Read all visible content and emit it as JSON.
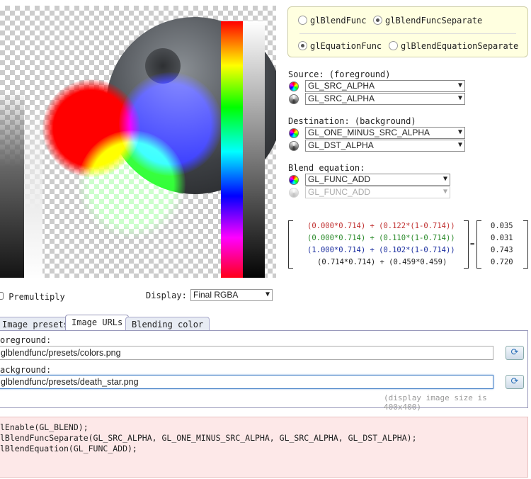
{
  "blend_function": {
    "options": [
      {
        "label": "glBlendFunc",
        "selected": false
      },
      {
        "label": "glBlendFuncSeparate",
        "selected": true
      }
    ]
  },
  "blend_equation_function": {
    "options": [
      {
        "label": "glEquationFunc",
        "selected": true
      },
      {
        "label": "glBlendEquationSeparate",
        "selected": false
      }
    ]
  },
  "source": {
    "label": "Source: (foreground)",
    "rgb": "GL_SRC_ALPHA",
    "alpha": "GL_SRC_ALPHA"
  },
  "destination": {
    "label": "Destination: (background)",
    "rgb": "GL_ONE_MINUS_SRC_ALPHA",
    "alpha": "GL_DST_ALPHA"
  },
  "equation": {
    "label": "Blend equation:",
    "rgb": "GL_FUNC_ADD",
    "alpha": "GL_FUNC_ADD"
  },
  "formula": {
    "rows": [
      {
        "expr": "(0.000*0.714) + (0.122*(1-0.714))",
        "result": "0.035",
        "color": "#c03030"
      },
      {
        "expr": "(0.000*0.714) + (0.110*(1-0.714))",
        "result": "0.031",
        "color": "#2a8a2a"
      },
      {
        "expr": "(1.000*0.714) + (0.102*(1-0.714))",
        "result": "0.743",
        "color": "#1c2fa0"
      },
      {
        "expr": "(0.714*0.714) + (0.459*0.459)",
        "result": "0.720",
        "color": "#222222"
      }
    ],
    "equals": "="
  },
  "premultiply_label": "Premultiply",
  "display": {
    "label": "Display:",
    "value": "Final RGBA"
  },
  "tabs": [
    {
      "label": "Image presets",
      "active": false
    },
    {
      "label": "Image URLs",
      "active": true
    },
    {
      "label": "Blending color",
      "active": false
    }
  ],
  "urls": {
    "foreground_label": "oreground:",
    "foreground_value": "glblendfunc/presets/colors.png",
    "background_label": "ackground:",
    "background_value": "glblendfunc/presets/death_star.png",
    "note": "(display image size is 400x400)"
  },
  "code_lines": [
    "lEnable(GL_BLEND);",
    "lBlendFuncSeparate(GL_SRC_ALPHA, GL_ONE_MINUS_SRC_ALPHA, GL_SRC_ALPHA, GL_DST_ALPHA);",
    "lBlendEquation(GL_FUNC_ADD);"
  ]
}
